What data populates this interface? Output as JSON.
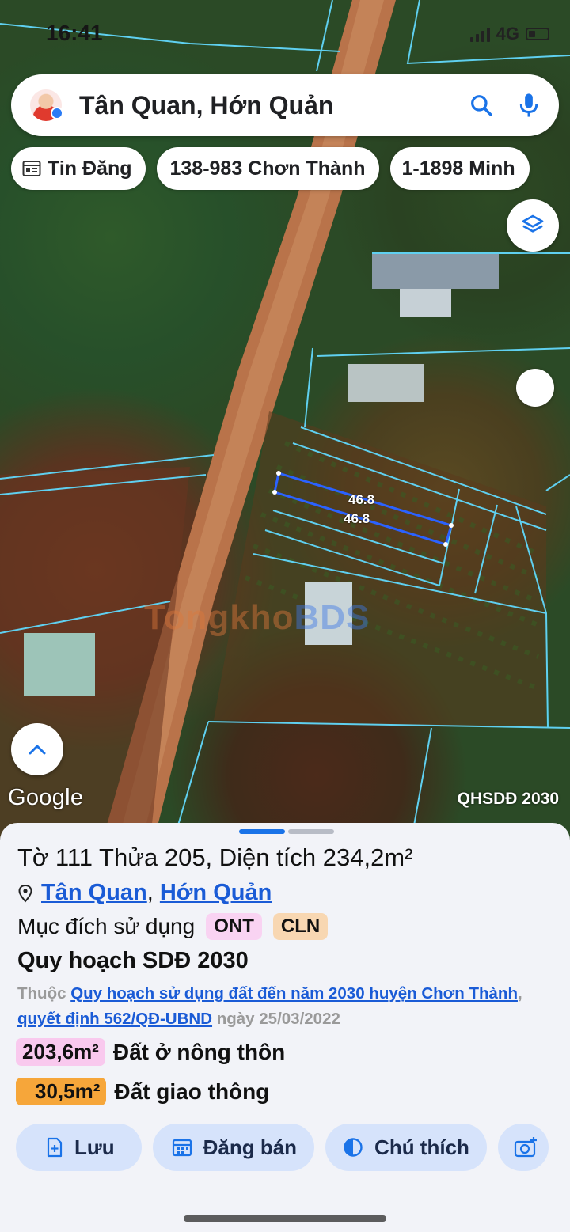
{
  "status_bar": {
    "time": "16:41",
    "network": "4G"
  },
  "search": {
    "query": "Tân Quan, Hớn Quản"
  },
  "chips": [
    {
      "label": "Tin Đăng",
      "icon": "news-icon"
    },
    {
      "label": "138-983 Chơn Thành"
    },
    {
      "label": "1-1898 Minh"
    }
  ],
  "map": {
    "google_label": "Google",
    "overlay_label": "QHSDĐ 2030",
    "watermark_a": "Tongkho",
    "watermark_b": "BDS",
    "dimension_1": "46.8",
    "dimension_2": "46.8"
  },
  "parcel": {
    "title": "Tờ 111 Thửa 205, Diện tích 234,2m²",
    "commune": "Tân Quan",
    "district": "Hớn Quản",
    "purpose_label": "Mục đích sử dụng",
    "purpose_tags": [
      {
        "code": "ONT",
        "color": "#f9d3f2"
      },
      {
        "code": "CLN",
        "color": "#f8d7b2"
      }
    ],
    "plan_heading": "Quy hoạch SDĐ 2030",
    "plan_prefix": "Thuộc",
    "plan_link": "Quy hoạch sử dụng đất đến năm 2030 huyện Chơn Thành",
    "plan_sep": ",",
    "decision_link": "quyết định 562/QĐ-UBND",
    "plan_date": "ngày 25/03/2022",
    "areas": [
      {
        "value": "203,6m²",
        "label": "Đất ở nông thôn",
        "color": "#f9c9ee"
      },
      {
        "value": "30,5m²",
        "label": "Đất giao thông",
        "color": "#f6a63a",
        "fill": 0.2
      }
    ]
  },
  "actions": [
    {
      "label": "Lưu",
      "icon": "save-doc-icon"
    },
    {
      "label": "Đăng bán",
      "icon": "calendar-icon"
    },
    {
      "label": "Chú thích",
      "icon": "contrast-icon"
    }
  ],
  "colors": {
    "accent": "#1a73e8",
    "link": "#1a5bd6",
    "parcel_line": "#2b62ff",
    "boundary": "#5fd0f0"
  }
}
